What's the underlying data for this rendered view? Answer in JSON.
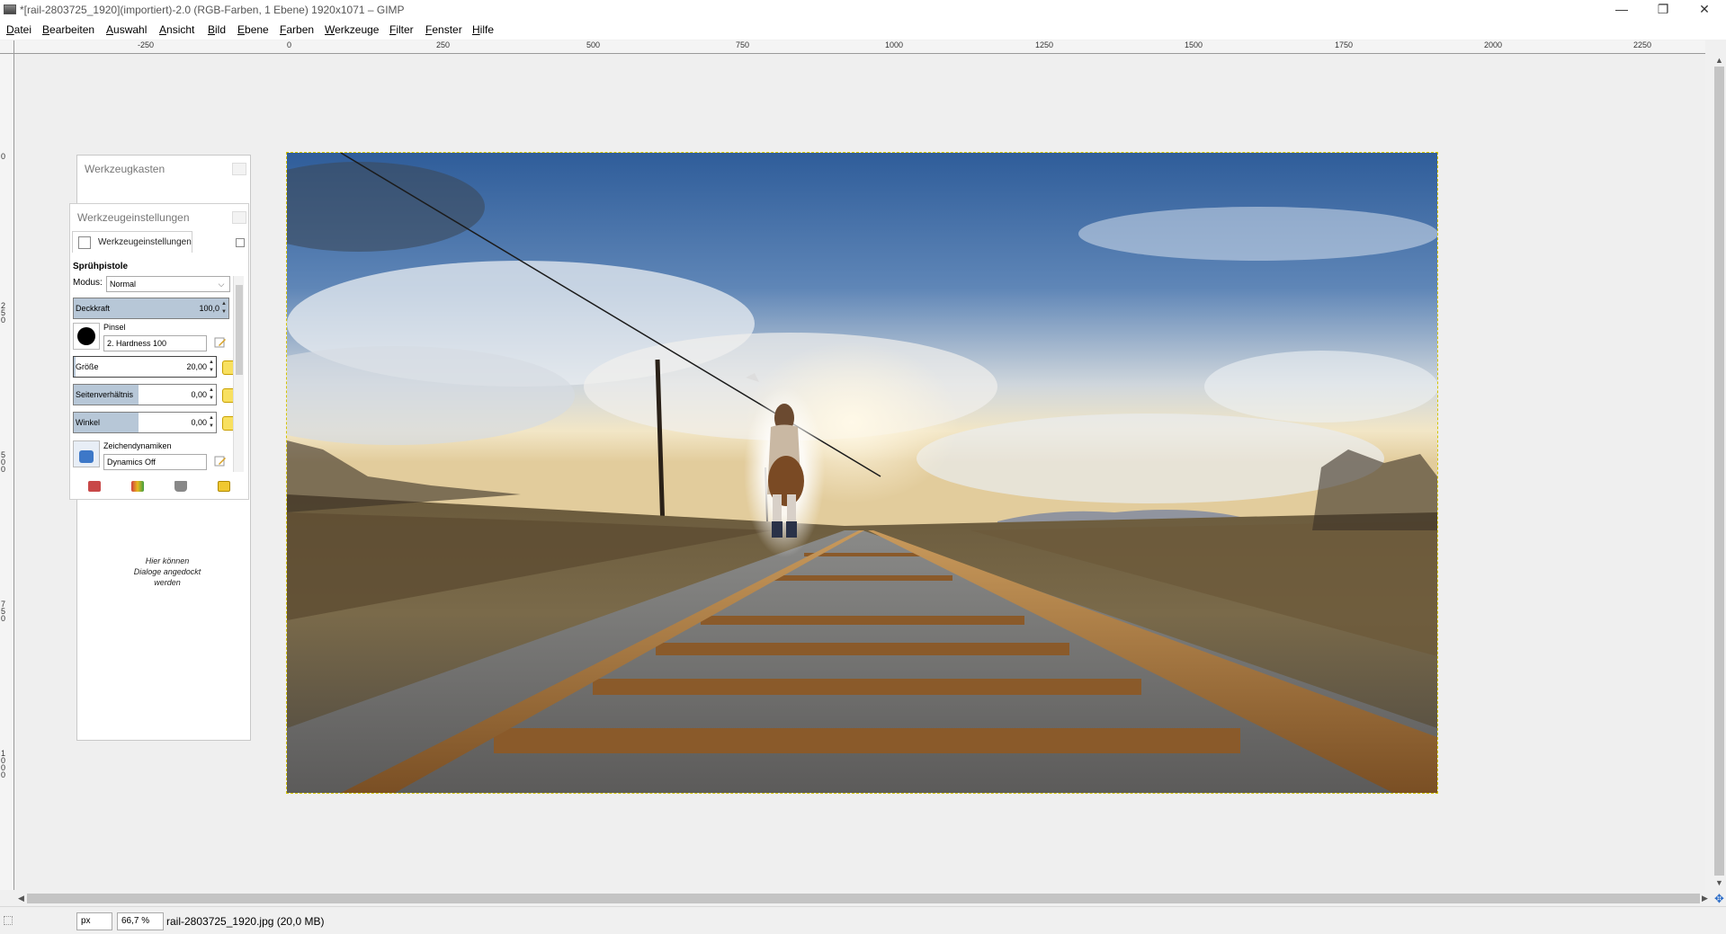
{
  "window": {
    "title": "*[rail-2803725_1920](importiert)-2.0 (RGB-Farben, 1 Ebene) 1920x1071 – GIMP",
    "minimize": "—",
    "maximize": "❐",
    "close": "✕"
  },
  "menu": [
    "Datei",
    "Bearbeiten",
    "Auswahl",
    "Ansicht",
    "Bild",
    "Ebene",
    "Farben",
    "Werkzeuge",
    "Filter",
    "Fenster",
    "Hilfe"
  ],
  "ruler": {
    "top_labels": [
      "-250",
      "0",
      "250",
      "500",
      "750",
      "1000",
      "1250",
      "1500",
      "1750",
      "2000",
      "2250"
    ],
    "left_labels": [
      "0",
      "250",
      "500",
      "750",
      "1000"
    ]
  },
  "toolbox": {
    "title": "Werkzeugkasten",
    "dock_hint": "Hier können Dialoge angedockt werden"
  },
  "tool_options": {
    "panel_title": "Werkzeugeinstellungen",
    "tab_label": "Werkzeugeinstellungen",
    "tool_name": "Sprühpistole",
    "mode_label": "Modus:",
    "mode_value": "Normal",
    "opacity_label": "Deckkraft",
    "opacity_value": "100,0",
    "opacity_fraction": 1.0,
    "brush_label": "Pinsel",
    "brush_value": "2. Hardness 100",
    "size_label": "Größe",
    "size_value": "20,00",
    "aspect_label": "Seitenverhältnis",
    "aspect_value": "0,00",
    "angle_label": "Winkel",
    "angle_value": "0,00",
    "dynamics_label": "Zeichendynamiken",
    "dynamics_value": "Dynamics Off"
  },
  "statusbar": {
    "unit": "px",
    "zoom": "66,7 %",
    "file_info": "rail-2803725_1920.jpg (20,0 MB)"
  },
  "colors": {
    "slider_fill": "#b7c7d7",
    "selection_outline": "#d4c400"
  }
}
